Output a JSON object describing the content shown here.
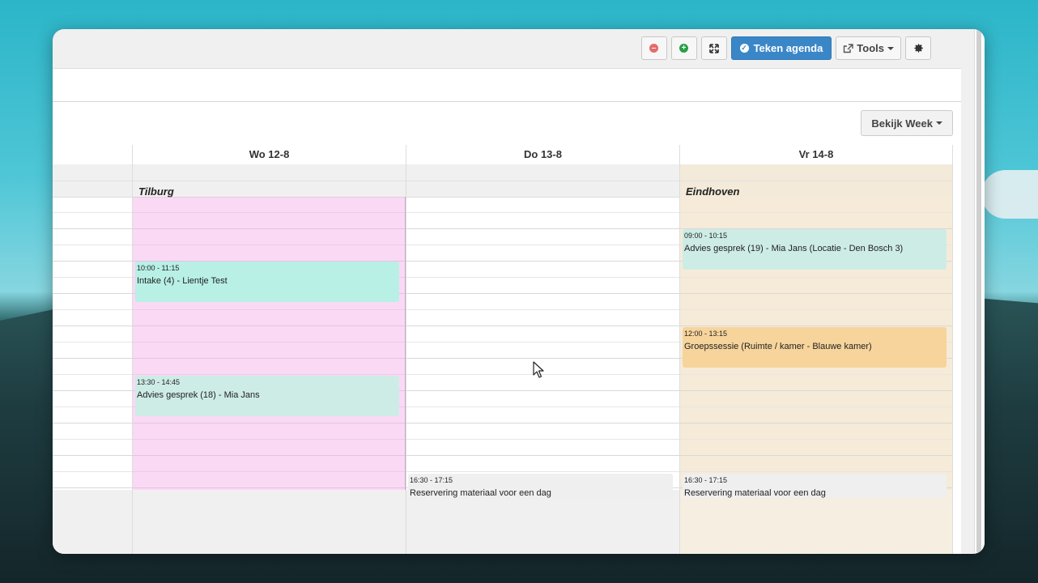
{
  "toolbar": {
    "teken_label": "Teken agenda",
    "tools_label": "Tools"
  },
  "view_button": "Bekijk Week",
  "days": [
    {
      "label": "Wo 12-8",
      "location": "Tilburg"
    },
    {
      "label": "Do 13-8",
      "location": ""
    },
    {
      "label": "Vr 14-8",
      "location": "Eindhoven"
    }
  ],
  "events": {
    "wo": [
      {
        "time": "10:00 - 11:15",
        "title": "Intake (4) - Lientje Test"
      },
      {
        "time": "13:30 - 14:45",
        "title": "Advies gesprek (18) - Mia Jans"
      }
    ],
    "do": [
      {
        "time": "16:30 - 17:15",
        "title": "Reservering materiaal voor een dag"
      }
    ],
    "vr": [
      {
        "time": "09:00 - 10:15",
        "title": "Advies gesprek (19) - Mia Jans (Locatie - Den Bosch 3)"
      },
      {
        "time": "12:00 - 13:15",
        "title": "Groepssessie (Ruimte / kamer - Blauwe kamer)"
      },
      {
        "time": "16:30 - 17:15",
        "title": "Reservering materiaal voor een dag"
      }
    ]
  },
  "colors": {
    "tilburg_availability": "#f8d6f4",
    "eindhoven_availability": "#f6ebd9",
    "intake": "#b8f0e6",
    "advies": "#cdece6",
    "groep": "#f6d49b",
    "reservering": "#efefef",
    "primary": "#3a87c8"
  },
  "icons": [
    "minus-circle-icon",
    "plus-circle-icon",
    "expand-icon",
    "check-circle-icon",
    "external-link-icon",
    "gear-icon",
    "caret-down-icon",
    "mouse-cursor-icon"
  ]
}
